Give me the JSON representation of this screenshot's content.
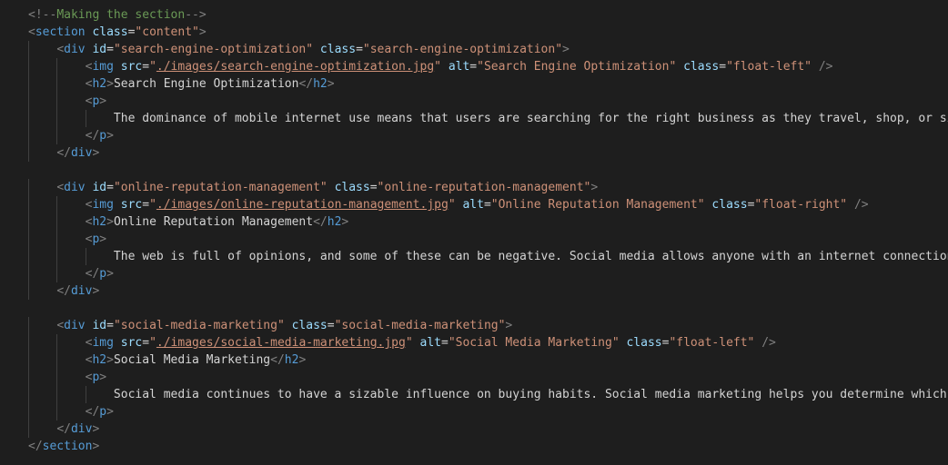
{
  "editor": {
    "lines": [
      [
        {
          "c": "t",
          "v": "<!--"
        },
        {
          "c": "cm",
          "v": "Making the section"
        },
        {
          "c": "t",
          "v": "-->"
        }
      ],
      [
        {
          "c": "t",
          "v": "<"
        },
        {
          "c": "tg",
          "v": "section"
        },
        {
          "c": "tx",
          "v": " "
        },
        {
          "c": "at",
          "v": "class"
        },
        {
          "c": "eq",
          "v": "="
        },
        {
          "c": "st",
          "v": "\"content\""
        },
        {
          "c": "t",
          "v": ">"
        }
      ],
      [
        {
          "c": "tx",
          "v": "    "
        },
        {
          "c": "t",
          "v": "<"
        },
        {
          "c": "tg",
          "v": "div"
        },
        {
          "c": "tx",
          "v": " "
        },
        {
          "c": "at",
          "v": "id"
        },
        {
          "c": "eq",
          "v": "="
        },
        {
          "c": "st",
          "v": "\"search-engine-optimization\""
        },
        {
          "c": "tx",
          "v": " "
        },
        {
          "c": "at",
          "v": "class"
        },
        {
          "c": "eq",
          "v": "="
        },
        {
          "c": "st",
          "v": "\"search-engine-optimization\""
        },
        {
          "c": "t",
          "v": ">"
        }
      ],
      [
        {
          "c": "tx",
          "v": "        "
        },
        {
          "c": "t",
          "v": "<"
        },
        {
          "c": "tg",
          "v": "img"
        },
        {
          "c": "tx",
          "v": " "
        },
        {
          "c": "at",
          "v": "src"
        },
        {
          "c": "eq",
          "v": "="
        },
        {
          "c": "st",
          "v": "\""
        },
        {
          "c": "st ul",
          "v": "./images/search-engine-optimization.jpg"
        },
        {
          "c": "st",
          "v": "\""
        },
        {
          "c": "tx",
          "v": " "
        },
        {
          "c": "at",
          "v": "alt"
        },
        {
          "c": "eq",
          "v": "="
        },
        {
          "c": "st",
          "v": "\"Search Engine Optimization\""
        },
        {
          "c": "tx",
          "v": " "
        },
        {
          "c": "at",
          "v": "class"
        },
        {
          "c": "eq",
          "v": "="
        },
        {
          "c": "st",
          "v": "\"float-left\""
        },
        {
          "c": "tx",
          "v": " "
        },
        {
          "c": "t",
          "v": "/>"
        }
      ],
      [
        {
          "c": "tx",
          "v": "        "
        },
        {
          "c": "t",
          "v": "<"
        },
        {
          "c": "tg",
          "v": "h2"
        },
        {
          "c": "t",
          "v": ">"
        },
        {
          "c": "tx",
          "v": "Search Engine Optimization"
        },
        {
          "c": "t",
          "v": "</"
        },
        {
          "c": "tg",
          "v": "h2"
        },
        {
          "c": "t",
          "v": ">"
        }
      ],
      [
        {
          "c": "tx",
          "v": "        "
        },
        {
          "c": "t",
          "v": "<"
        },
        {
          "c": "tg",
          "v": "p"
        },
        {
          "c": "t",
          "v": ">"
        }
      ],
      [
        {
          "c": "tx",
          "v": "            The dominance of mobile internet use means that users are searching for the right business as they travel, shop, or sit"
        }
      ],
      [
        {
          "c": "tx",
          "v": "        "
        },
        {
          "c": "t",
          "v": "</"
        },
        {
          "c": "tg",
          "v": "p"
        },
        {
          "c": "t",
          "v": ">"
        }
      ],
      [
        {
          "c": "tx",
          "v": "    "
        },
        {
          "c": "t",
          "v": "</"
        },
        {
          "c": "tg",
          "v": "div"
        },
        {
          "c": "t",
          "v": ">"
        }
      ],
      [],
      [
        {
          "c": "tx",
          "v": "    "
        },
        {
          "c": "t",
          "v": "<"
        },
        {
          "c": "tg",
          "v": "div"
        },
        {
          "c": "tx",
          "v": " "
        },
        {
          "c": "at",
          "v": "id"
        },
        {
          "c": "eq",
          "v": "="
        },
        {
          "c": "st",
          "v": "\"online-reputation-management\""
        },
        {
          "c": "tx",
          "v": " "
        },
        {
          "c": "at",
          "v": "class"
        },
        {
          "c": "eq",
          "v": "="
        },
        {
          "c": "st",
          "v": "\"online-reputation-management\""
        },
        {
          "c": "t",
          "v": ">"
        }
      ],
      [
        {
          "c": "tx",
          "v": "        "
        },
        {
          "c": "t",
          "v": "<"
        },
        {
          "c": "tg",
          "v": "img"
        },
        {
          "c": "tx",
          "v": " "
        },
        {
          "c": "at",
          "v": "src"
        },
        {
          "c": "eq",
          "v": "="
        },
        {
          "c": "st",
          "v": "\""
        },
        {
          "c": "st ul",
          "v": "./images/online-reputation-management.jpg"
        },
        {
          "c": "st",
          "v": "\""
        },
        {
          "c": "tx",
          "v": " "
        },
        {
          "c": "at",
          "v": "alt"
        },
        {
          "c": "eq",
          "v": "="
        },
        {
          "c": "st",
          "v": "\"Online Reputation Management\""
        },
        {
          "c": "tx",
          "v": " "
        },
        {
          "c": "at",
          "v": "class"
        },
        {
          "c": "eq",
          "v": "="
        },
        {
          "c": "st",
          "v": "\"float-right\""
        },
        {
          "c": "tx",
          "v": " "
        },
        {
          "c": "t",
          "v": "/>"
        }
      ],
      [
        {
          "c": "tx",
          "v": "        "
        },
        {
          "c": "t",
          "v": "<"
        },
        {
          "c": "tg",
          "v": "h2"
        },
        {
          "c": "t",
          "v": ">"
        },
        {
          "c": "tx",
          "v": "Online Reputation Management"
        },
        {
          "c": "t",
          "v": "</"
        },
        {
          "c": "tg",
          "v": "h2"
        },
        {
          "c": "t",
          "v": ">"
        }
      ],
      [
        {
          "c": "tx",
          "v": "        "
        },
        {
          "c": "t",
          "v": "<"
        },
        {
          "c": "tg",
          "v": "p"
        },
        {
          "c": "t",
          "v": ">"
        }
      ],
      [
        {
          "c": "tx",
          "v": "            The web is full of opinions, and some of these can be negative. Social media allows anyone with an internet connection t"
        }
      ],
      [
        {
          "c": "tx",
          "v": "        "
        },
        {
          "c": "t",
          "v": "</"
        },
        {
          "c": "tg",
          "v": "p"
        },
        {
          "c": "t",
          "v": ">"
        }
      ],
      [
        {
          "c": "tx",
          "v": "    "
        },
        {
          "c": "t",
          "v": "</"
        },
        {
          "c": "tg",
          "v": "div"
        },
        {
          "c": "t",
          "v": ">"
        }
      ],
      [],
      [
        {
          "c": "tx",
          "v": "    "
        },
        {
          "c": "t",
          "v": "<"
        },
        {
          "c": "tg",
          "v": "div"
        },
        {
          "c": "tx",
          "v": " "
        },
        {
          "c": "at",
          "v": "id"
        },
        {
          "c": "eq",
          "v": "="
        },
        {
          "c": "st",
          "v": "\"social-media-marketing\""
        },
        {
          "c": "tx",
          "v": " "
        },
        {
          "c": "at",
          "v": "class"
        },
        {
          "c": "eq",
          "v": "="
        },
        {
          "c": "st",
          "v": "\"social-media-marketing\""
        },
        {
          "c": "t",
          "v": ">"
        }
      ],
      [
        {
          "c": "tx",
          "v": "        "
        },
        {
          "c": "t",
          "v": "<"
        },
        {
          "c": "tg",
          "v": "img"
        },
        {
          "c": "tx",
          "v": " "
        },
        {
          "c": "at",
          "v": "src"
        },
        {
          "c": "eq",
          "v": "="
        },
        {
          "c": "st",
          "v": "\""
        },
        {
          "c": "st ul",
          "v": "./images/social-media-marketing.jpg"
        },
        {
          "c": "st",
          "v": "\""
        },
        {
          "c": "tx",
          "v": " "
        },
        {
          "c": "at",
          "v": "alt"
        },
        {
          "c": "eq",
          "v": "="
        },
        {
          "c": "st",
          "v": "\"Social Media Marketing\""
        },
        {
          "c": "tx",
          "v": " "
        },
        {
          "c": "at",
          "v": "class"
        },
        {
          "c": "eq",
          "v": "="
        },
        {
          "c": "st",
          "v": "\"float-left\""
        },
        {
          "c": "tx",
          "v": " "
        },
        {
          "c": "t",
          "v": "/>"
        }
      ],
      [
        {
          "c": "tx",
          "v": "        "
        },
        {
          "c": "t",
          "v": "<"
        },
        {
          "c": "tg",
          "v": "h2"
        },
        {
          "c": "t",
          "v": ">"
        },
        {
          "c": "tx",
          "v": "Social Media Marketing"
        },
        {
          "c": "t",
          "v": "</"
        },
        {
          "c": "tg",
          "v": "h2"
        },
        {
          "c": "t",
          "v": ">"
        }
      ],
      [
        {
          "c": "tx",
          "v": "        "
        },
        {
          "c": "t",
          "v": "<"
        },
        {
          "c": "tg",
          "v": "p"
        },
        {
          "c": "t",
          "v": ">"
        }
      ],
      [
        {
          "c": "tx",
          "v": "            Social media continues to have a sizable influence on buying habits. Social media marketing helps you determine which pl"
        }
      ],
      [
        {
          "c": "tx",
          "v": "        "
        },
        {
          "c": "t",
          "v": "</"
        },
        {
          "c": "tg",
          "v": "p"
        },
        {
          "c": "t",
          "v": ">"
        }
      ],
      [
        {
          "c": "tx",
          "v": "    "
        },
        {
          "c": "t",
          "v": "</"
        },
        {
          "c": "tg",
          "v": "div"
        },
        {
          "c": "t",
          "v": ">"
        }
      ],
      [
        {
          "c": "t",
          "v": "</"
        },
        {
          "c": "tg",
          "v": "section"
        },
        {
          "c": "t",
          "v": ">"
        }
      ]
    ],
    "colors": {
      "background": "#1e1e1e",
      "punctuation": "#808080",
      "tag": "#569cd6",
      "attribute": "#9cdcfe",
      "string": "#ce9178",
      "text": "#d4d4d4",
      "comment": "#6a9955"
    }
  }
}
